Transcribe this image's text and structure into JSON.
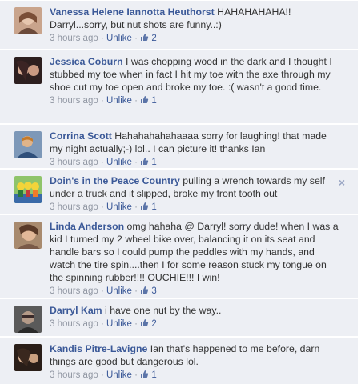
{
  "comments": [
    {
      "author": "Vanessa Helene Iannotta Heuthorst",
      "text": " HAHAHAHAHA!! Darryl...sorry, but nut shots are funny..:)",
      "time": "3 hours ago",
      "sep1": " · ",
      "action": "Unlike",
      "sep2": " · ",
      "likes": "2",
      "avatar_colors": [
        "#b58a6e",
        "#6b4a3a"
      ]
    },
    {
      "author": "Jessica Coburn",
      "text": " I was chopping wood in the dark and I thought I stubbed my toe when in fact I hit my toe with the axe through my shoe cut my toe open and broke my toe. :( wasn't a good time.",
      "time": "3 hours ago",
      "sep1": " · ",
      "action": "Unlike",
      "sep2": " · ",
      "likes": "1",
      "avatar_colors": [
        "#3a2a2a",
        "#c7a18c"
      ]
    },
    {
      "author": "Corrina Scott",
      "text": " Hahahahahahaaaa sorry for laughing! that made my night actually;-) lol.. I can picture it! thanks Ian",
      "time": "3 hours ago",
      "sep1": " · ",
      "action": "Unlike",
      "sep2": " · ",
      "likes": "1",
      "avatar_colors": [
        "#5f7fa8",
        "#d8a35a"
      ]
    },
    {
      "author": "Doin's in the Peace Country",
      "text": " pulling a wrench towards my self under a truck and it slipped, broke my front tooth out",
      "time": "3 hours ago",
      "sep1": " · ",
      "action": "Unlike",
      "sep2": " · ",
      "likes": "1",
      "avatar_colors": [
        "#2c7a3a",
        "#f0d23a"
      ]
    },
    {
      "author": "Linda Anderson",
      "text": " omg hahaha @ Darryl! sorry dude! when I was a kid I turned my 2 wheel bike over, balancing it on its seat and handle bars so I could pump the peddles with my hands, and watch the tire spin....then I for some reason stuck my tongue on the spinning rubber!!!! OUCHIE!!! I win!",
      "time": "3 hours ago",
      "sep1": " · ",
      "action": "Unlike",
      "sep2": " · ",
      "likes": "3",
      "avatar_colors": [
        "#c48d6a",
        "#5a3c2c"
      ]
    },
    {
      "author": "Darryl Kam",
      "text": " i have one nut by the way..",
      "time": "3 hours ago",
      "sep1": " · ",
      "action": "Unlike",
      "sep2": " · ",
      "likes": "2",
      "avatar_colors": [
        "#4a4a4a",
        "#9a8a7a"
      ]
    },
    {
      "author": "Kandis Pitre-Lavigne",
      "text": " Ian that's happened to me before, darn things are good but dangerous lol.",
      "time": "3 hours ago",
      "sep1": " · ",
      "action": "Unlike",
      "sep2": " · ",
      "likes": "1",
      "avatar_colors": [
        "#3a2a22",
        "#d9b89a"
      ]
    }
  ],
  "close_glyph": "×",
  "colors": {
    "background": "#edeff4",
    "link": "#3b5998",
    "meta": "#9197a3"
  }
}
